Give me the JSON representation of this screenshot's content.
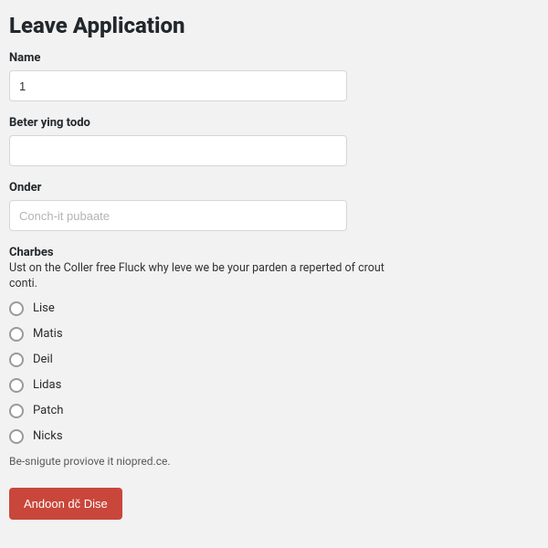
{
  "title": "Leave Application",
  "fields": {
    "name": {
      "label": "Name",
      "value": "1"
    },
    "beter": {
      "label": "Beter ying todo",
      "value": ""
    },
    "onder": {
      "label": "Onder",
      "placeholder": "Conch-it pubaate",
      "value": ""
    }
  },
  "radio_group": {
    "label": "Charbes",
    "description": "Ust on the Coller free Fluck why leve we be your parden a reperted of crout conti.",
    "options": [
      "Lise",
      "Matis",
      "Deil",
      "Lidas",
      "Patch",
      "Nicks"
    ]
  },
  "helper_text": "Be-snigute proviove it niopred.ce.",
  "submit_label": "Andoon dč Dise"
}
